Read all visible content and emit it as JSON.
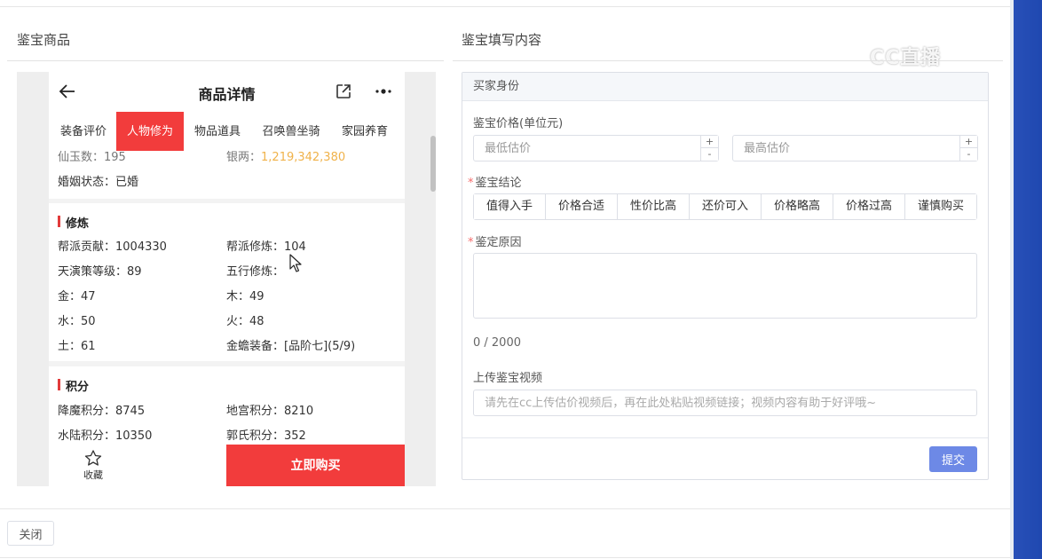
{
  "left_section": {
    "title": "鉴宝商品"
  },
  "right_section": {
    "title": "鉴宝填写内容"
  },
  "phone": {
    "title": "商品详情",
    "tabs": [
      "装备评价",
      "人物修为",
      "物品道具",
      "召唤兽坐骑",
      "家园养育"
    ],
    "active_tab": "人物修为",
    "top_card": {
      "row1_left": "仙玉数：195",
      "row1_right_label": "银两：",
      "row1_right_value": "1,219,342,380",
      "row2_left": "婚姻状态：已婚"
    },
    "cultivation": {
      "heading": "修炼",
      "items": [
        [
          "帮派贡献：1004330",
          "帮派修炼：104"
        ],
        [
          "天演策等级：89",
          "五行修炼："
        ],
        [
          "金：47",
          "木：49"
        ],
        [
          "水：50",
          "火：48"
        ],
        [
          "土：61",
          "金蟾装备：[品阶七](5/9)"
        ]
      ]
    },
    "points": {
      "heading": "积分",
      "items": [
        [
          "降魔积分：8745",
          "地宫积分：8210"
        ],
        [
          "水陆积分：10350",
          "郭氏积分：352"
        ]
      ]
    },
    "favorite_label": "收藏",
    "buy_label": "立即购买"
  },
  "form": {
    "header": "买家身份",
    "price_label": "鉴宝价格(单位元)",
    "min_placeholder": "最低估价",
    "max_placeholder": "最高估价",
    "conclusion_label": "鉴宝结论",
    "verdicts": [
      "值得入手",
      "价格合适",
      "性价比高",
      "还价可入",
      "价格略高",
      "价格过高",
      "谨慎购买"
    ],
    "reason_label": "鉴定原因",
    "counter": "0 / 2000",
    "video_label": "上传鉴宝视频",
    "video_placeholder": "请先在cc上传估价视频后，再在此处粘贴视频链接；视频内容有助于好评哦~",
    "submit_label": "提交"
  },
  "footer": {
    "close_label": "关闭"
  },
  "watermark": "CC直播"
}
